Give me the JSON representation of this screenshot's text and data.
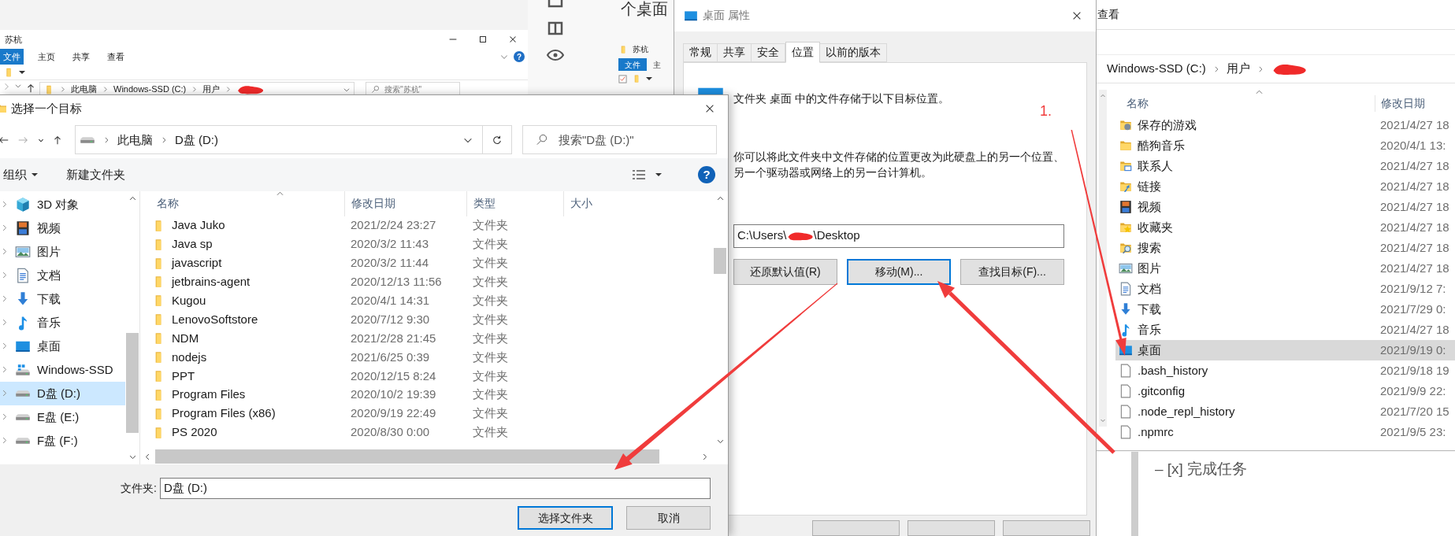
{
  "back_explorer": {
    "title": "苏杭",
    "ribbon_tabs": [
      {
        "label": "文件",
        "selected": true
      },
      {
        "label": "主页",
        "selected": false
      },
      {
        "label": "共享",
        "selected": false
      },
      {
        "label": "查看",
        "selected": false
      }
    ],
    "help_glyph": "?",
    "breadcrumbs": [
      "此电脑",
      "Windows-SSD (C:)",
      "用户"
    ],
    "search_placeholder": "搜索\"苏杭\""
  },
  "side_panel": {
    "heading": "个桌面",
    "mini_title": "苏杭",
    "mini_tabs": [
      {
        "label": "文件",
        "selected": true
      },
      {
        "label": "主",
        "selected": false
      }
    ]
  },
  "choose_dialog": {
    "title": "选择一个目标",
    "breadcrumbs": [
      "此电脑",
      "D盘 (D:)"
    ],
    "search_placeholder": "搜索\"D盘 (D:)\"",
    "toolbar": [
      "组织",
      "新建文件夹"
    ],
    "help_glyph": "?",
    "nav_items": [
      {
        "label": "3D 对象",
        "kind": "cube",
        "selected": false
      },
      {
        "label": "视频",
        "kind": "video",
        "selected": false
      },
      {
        "label": "图片",
        "kind": "picture",
        "selected": false
      },
      {
        "label": "文档",
        "kind": "document",
        "selected": false
      },
      {
        "label": "下载",
        "kind": "download",
        "selected": false
      },
      {
        "label": "音乐",
        "kind": "music",
        "selected": false
      },
      {
        "label": "桌面",
        "kind": "desktop",
        "selected": false
      },
      {
        "label": "Windows-SSD",
        "kind": "systemdrive",
        "selected": false
      },
      {
        "label": "D盘 (D:)",
        "kind": "drive",
        "selected": true
      },
      {
        "label": "E盘 (E:)",
        "kind": "drive",
        "selected": false
      },
      {
        "label": "F盘 (F:)",
        "kind": "drive",
        "selected": false
      }
    ],
    "columns": [
      "名称",
      "修改日期",
      "类型",
      "大小"
    ],
    "rows": [
      {
        "name": "Java Juko",
        "modified": "2021/2/24 23:27",
        "type": "文件夹"
      },
      {
        "name": "Java sp",
        "modified": "2020/3/2 11:43",
        "type": "文件夹"
      },
      {
        "name": "javascript",
        "modified": "2020/3/2 11:44",
        "type": "文件夹"
      },
      {
        "name": "jetbrains-agent",
        "modified": "2020/12/13 11:56",
        "type": "文件夹"
      },
      {
        "name": "Kugou",
        "modified": "2020/4/1 14:31",
        "type": "文件夹"
      },
      {
        "name": "LenovoSoftstore",
        "modified": "2020/7/12 9:30",
        "type": "文件夹"
      },
      {
        "name": "NDM",
        "modified": "2021/2/28 21:45",
        "type": "文件夹"
      },
      {
        "name": "nodejs",
        "modified": "2021/6/25 0:39",
        "type": "文件夹"
      },
      {
        "name": "PPT",
        "modified": "2020/12/15 8:24",
        "type": "文件夹"
      },
      {
        "name": "Program Files",
        "modified": "2020/10/2 19:39",
        "type": "文件夹"
      },
      {
        "name": "Program Files (x86)",
        "modified": "2020/9/19 22:49",
        "type": "文件夹"
      },
      {
        "name": "PS 2020",
        "modified": "2020/8/30 0:00",
        "type": "文件夹"
      }
    ],
    "folder_label": "文件夹:",
    "folder_value": "D盘 (D:)",
    "buttons": [
      {
        "label": "选择文件夹",
        "focused": true
      },
      {
        "label": "取消",
        "focused": false
      }
    ]
  },
  "properties_dialog": {
    "title": "桌面 属性",
    "tabs": [
      {
        "label": "常规",
        "selected": false
      },
      {
        "label": "共享",
        "selected": false
      },
      {
        "label": "安全",
        "selected": false
      },
      {
        "label": "位置",
        "selected": true
      },
      {
        "label": "以前的版本",
        "selected": false
      }
    ],
    "intro": "文件夹 桌面 中的文件存储于以下目标位置。",
    "description": "你可以将此文件夹中文件存储的位置更改为此硬盘上的另一个位置、另一个驱动器或网络上的另一台计算机。",
    "path_start": "C:\\Users\\",
    "path_end": "\\Desktop",
    "buttons": [
      {
        "label": "还原默认值(R)",
        "focused": false
      },
      {
        "label": "移动(M)...",
        "focused": true
      },
      {
        "label": "查找目标(F)...",
        "focused": false
      }
    ]
  },
  "user_explorer": {
    "ribbon_tab": "查看",
    "breadcrumbs": [
      "Windows-SSD (C:)",
      "用户"
    ],
    "columns": [
      "名称",
      "修改日期"
    ],
    "rows": [
      {
        "name": "保存的游戏",
        "modified": "2021/4/27 18",
        "kind": "game",
        "selected": false
      },
      {
        "name": "酷狗音乐",
        "modified": "2020/4/1 13:",
        "kind": "folder",
        "selected": false
      },
      {
        "name": "联系人",
        "modified": "2021/4/27 18",
        "kind": "contacts",
        "selected": false
      },
      {
        "name": "链接",
        "modified": "2021/4/27 18",
        "kind": "link",
        "selected": false
      },
      {
        "name": "视频",
        "modified": "2021/4/27 18",
        "kind": "video",
        "selected": false
      },
      {
        "name": "收藏夹",
        "modified": "2021/4/27 18",
        "kind": "favorites",
        "selected": false
      },
      {
        "name": "搜索",
        "modified": "2021/4/27 18",
        "kind": "search",
        "selected": false
      },
      {
        "name": "图片",
        "modified": "2021/4/27 18",
        "kind": "picture",
        "selected": false
      },
      {
        "name": "文档",
        "modified": "2021/9/12 7:",
        "kind": "document",
        "selected": false
      },
      {
        "name": "下载",
        "modified": "2021/7/29 0:",
        "kind": "download",
        "selected": false
      },
      {
        "name": "音乐",
        "modified": "2021/4/27 18",
        "kind": "music",
        "selected": false
      },
      {
        "name": "桌面",
        "modified": "2021/9/19 0:",
        "kind": "desktop",
        "selected": true
      },
      {
        "name": ".bash_history",
        "modified": "2021/9/18 19",
        "kind": "file",
        "selected": false
      },
      {
        "name": ".gitconfig",
        "modified": "2021/9/9 22:",
        "kind": "file",
        "selected": false
      },
      {
        "name": ".node_repl_history",
        "modified": "2021/7/20 15",
        "kind": "file",
        "selected": false
      },
      {
        "name": ".npmrc",
        "modified": "2021/9/5 23:",
        "kind": "file",
        "selected": false
      }
    ]
  },
  "note": "– [x] 完成任务",
  "annotation_label": "1."
}
